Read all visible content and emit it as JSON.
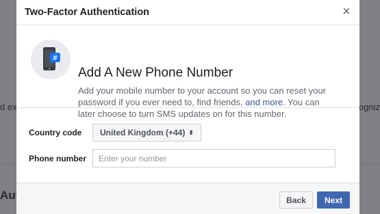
{
  "background": {
    "left_fragment": "d ex",
    "right_fragment": "cogniz",
    "heading_fragment": "Aut"
  },
  "dialog": {
    "title": "Two-Factor Authentication",
    "close_icon": "close-icon",
    "close_glyph": "×"
  },
  "intro": {
    "icon": "phone-hashtag-icon",
    "heading": "Add A New Phone Number",
    "text_before_link": "Add your mobile number to your account so you can reset your password if you ever need to, find friends, ",
    "link": "and more",
    "text_after_link": ". You can later choose to turn SMS updates on for this number."
  },
  "form": {
    "country_label": "Country code",
    "country_value": "United Kingdom (+44)",
    "country_arrows": "⬍",
    "phone_label": "Phone number",
    "phone_placeholder": "Enter your number",
    "phone_value": ""
  },
  "footer": {
    "back_label": "Back",
    "next_label": "Next"
  },
  "colors": {
    "accent": "#4267b2",
    "link": "#365899",
    "overlay": "#7f8083"
  }
}
